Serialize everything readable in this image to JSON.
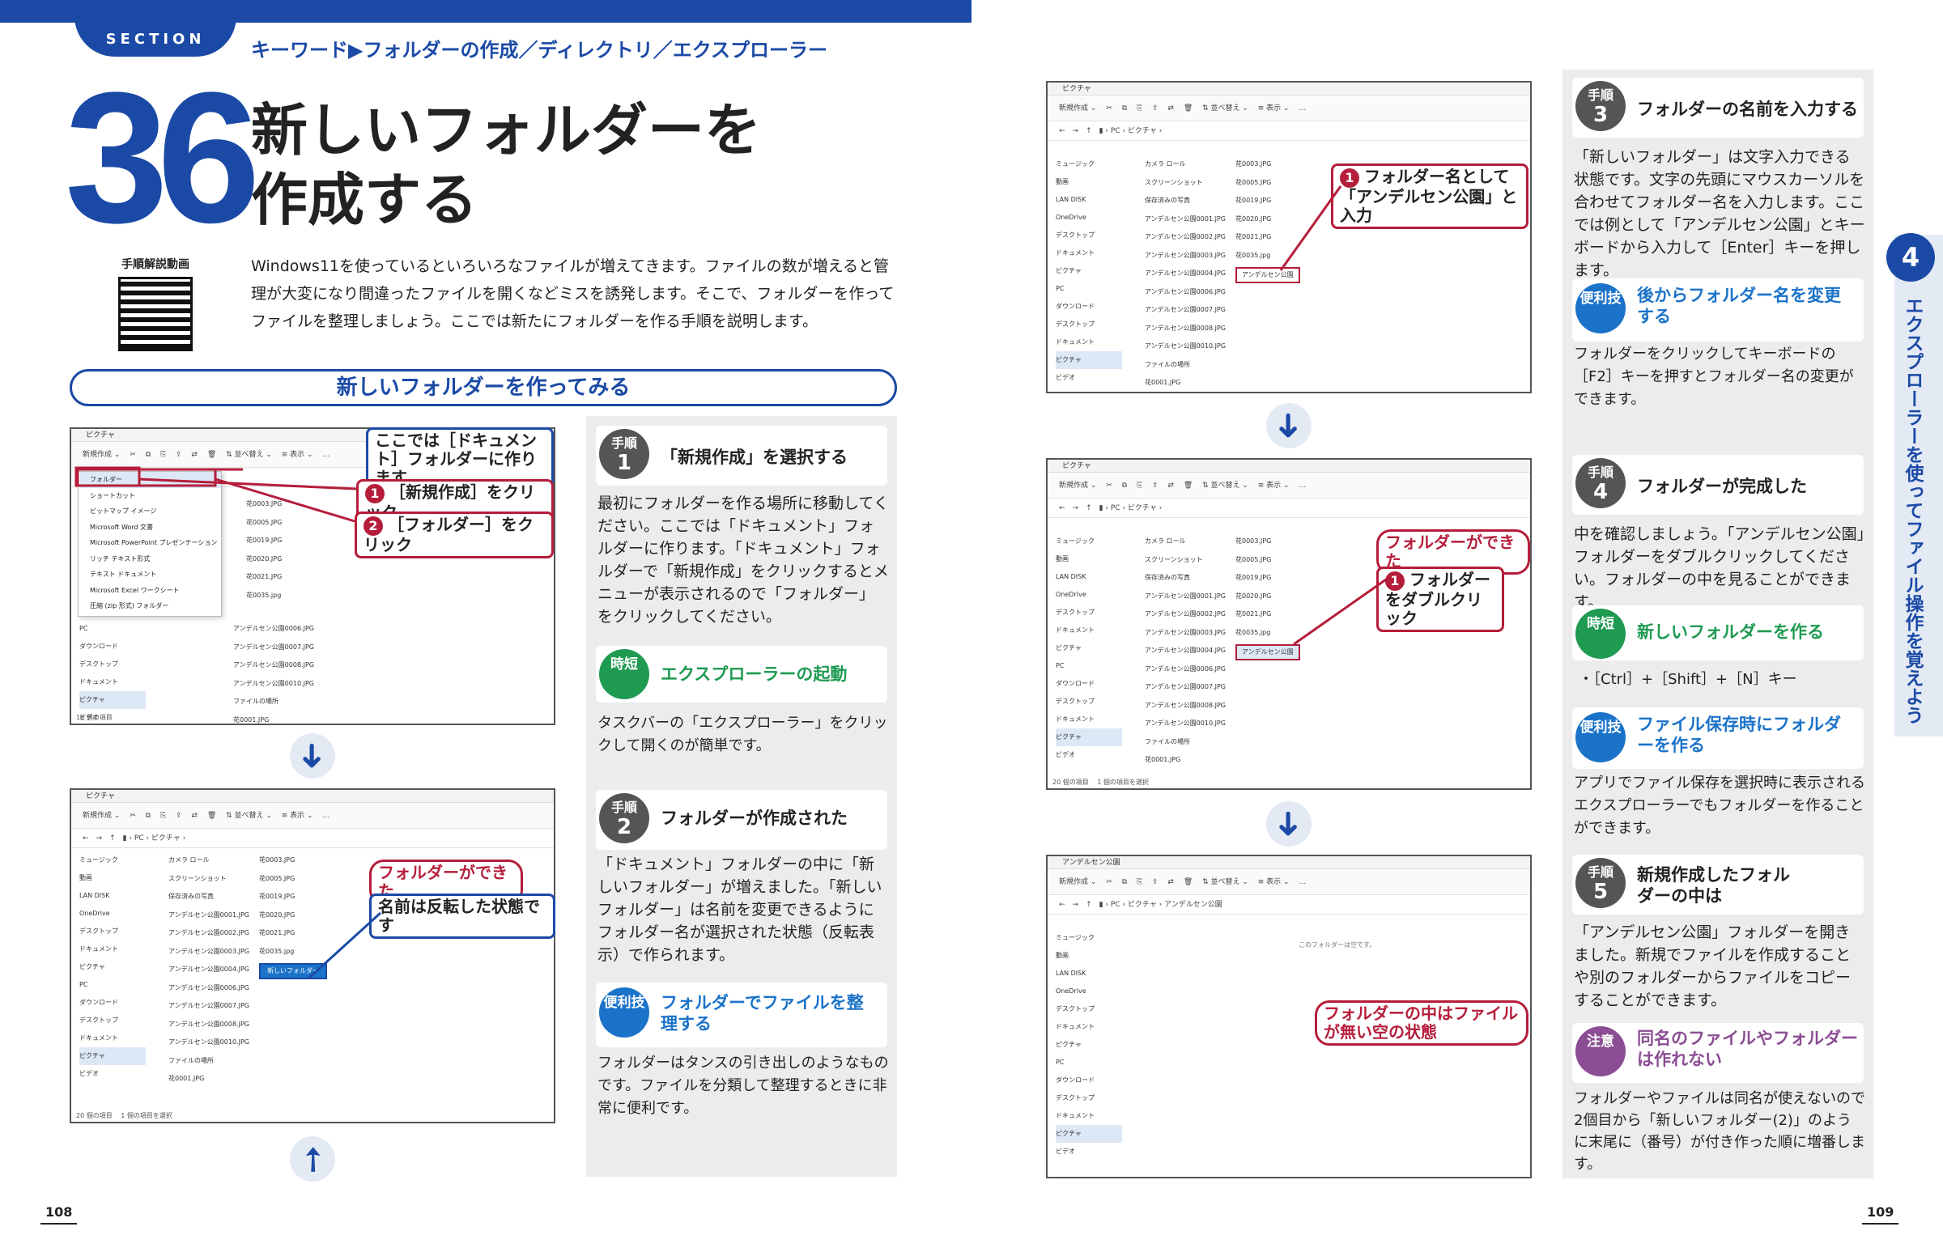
{
  "header": {
    "section_label": "SECTION",
    "keywords": "キーワード▶フォルダーの作成／ディレクトリ／エクスプローラー"
  },
  "title": {
    "number": "36",
    "line1": "新しいフォルダーを",
    "line2": "作成する"
  },
  "qr_label": "手順解説動画",
  "intro": "Windows11を使っているといろいろなファイルが増えてきます。ファイルの数が増えると管理が大変になり間違ったファイルを開くなどミスを誘発します。そこで、フォルダーを作ってファイルを整理しましょう。ここでは新たにフォルダーを作る手順を説明します。",
  "section_heading": "新しいフォルダーを作ってみる",
  "shots": {
    "window_title": "ピクチャ",
    "window_title_3": "アンデルセン公園",
    "toolbar": "新規作成 ⌄　 ✂　 ⧉　 ⎘　 ⇪　 ⇄　 🗑　 ⇅ 並べ替え ⌄　 ≡ 表示 ⌄　 …",
    "addr": "←　→　↑　▮ › PC › ピクチャ ›",
    "addr_3": "←　→　↑　▮ › PC › ピクチャ › アンデルセン公園",
    "menu": [
      "フォルダー",
      "ショートカット",
      "ビットマップ イメージ",
      "Microsoft Word 文書",
      "Microsoft PowerPoint プレゼンテーション",
      "リッチ テキスト形式",
      "テキスト ドキュメント",
      "Microsoft Excel ワークシート",
      "圧縮 (zip 形式) フォルダー"
    ],
    "nav": [
      "ミュージック",
      "動画",
      "LAN DISK",
      "OneDrive",
      "デスクトップ",
      "ドキュメント",
      "ピクチャ",
      "PC",
      "ダウンロード",
      "デスクトップ",
      "ドキュメント",
      "ピクチャ",
      "ビデオ"
    ],
    "files_col1": [
      "カメラ ロール",
      "スクリーンショット",
      "保存済みの写真",
      "アンデルセン公園0001.JPG",
      "アンデルセン公園0002.JPG",
      "アンデルセン公園0003.JPG",
      "アンデルセン公園0004.JPG",
      "アンデルセン公園0006.JPG",
      "アンデルセン公園0007.JPG",
      "アンデルセン公園0008.JPG",
      "アンデルセン公園0010.JPG",
      "ファイルの場所",
      "花0001.JPG"
    ],
    "files_col2": [
      "花0003.JPG",
      "花0005.JPG",
      "花0019.JPG",
      "花0020.JPG",
      "花0021.JPG",
      "花0035.jpg"
    ],
    "new_folder": "新しいフォルダー",
    "named_folder": "アンデルセン公園",
    "empty_msg": "このフォルダーは空です。",
    "status_1": "19 個の項目",
    "status_2": "20 個の項目　 1 個の項目を選択",
    "status_4": "20 個の項目　 1 個の項目を選択"
  },
  "callouts": {
    "c1": "ここでは［ドキュメント］フォルダーに作ります",
    "c2n": "1",
    "c2": "［新規作成］をクリック",
    "c3n": "2",
    "c3": "［フォルダー］をクリック",
    "c4": "フォルダーができた",
    "c5": "名前は反転した状態です",
    "c6n": "1",
    "c6": "フォルダー名として「アンデルセン公園」と入力",
    "c7": "フォルダーができた",
    "c8n": "1",
    "c8": "フォルダーをダブルクリック",
    "c9": "フォルダーの中はファイルが無い空の状態"
  },
  "arrows": {
    "down": "➜",
    "diag": "➚"
  },
  "steps": [
    {
      "label": "手順",
      "num": "1",
      "title": "「新規作成」を選択する",
      "body": "最初にフォルダーを作る場所に移動してください。ここでは「ドキュメント」フォルダーに作ります。「ドキュメント」フォルダーで「新規作成」をクリックするとメニューが表示されるので「フォルダー」をクリックしてください。"
    },
    {
      "label": "手順",
      "num": "2",
      "title": "フォルダーが作成された",
      "body": "「ドキュメント」フォルダーの中に「新しいフォルダー」が増えました。「新しいフォルダー」は名前を変更できるようにフォルダー名が選択された状態（反転表示）で作られます。"
    },
    {
      "label": "手順",
      "num": "3",
      "title": "フォルダーの名前を入力する",
      "body": "「新しいフォルダー」は文字入力できる状態です。文字の先頭にマウスカーソルを合わせてフォルダー名を入力します。ここでは例として「アンデルセン公園」とキーボードから入力して［Enter］キーを押します。"
    },
    {
      "label": "手順",
      "num": "4",
      "title": "フォルダーが完成した",
      "body": "中を確認しましょう。「アンデルセン公園」フォルダーをダブルクリックしてください。フォルダーの中を見ることができます。"
    },
    {
      "label": "手順",
      "num": "5",
      "title": "新規作成したフォルダーの中は",
      "body": "「アンデルセン公園」フォルダーを開きました。新規でファイルを作成することや別のフォルダーからファイルをコピーすることができます。"
    }
  ],
  "tips": [
    {
      "badge1": "時短",
      "title": "エクスプローラーの起動",
      "body": "タスクバーの「エクスプローラー」をクリックして開くのが簡単です。"
    },
    {
      "badge1": "便利技",
      "title": "フォルダーでファイルを整理する",
      "body": "フォルダーはタンスの引き出しのようなものです。ファイルを分類して整理するときに非常に便利です。"
    },
    {
      "badge1": "便利技",
      "title": "後からフォルダー名を変更する",
      "body": "フォルダーをクリックしてキーボードの［F2］キーを押すとフォルダー名の変更ができます。"
    },
    {
      "badge1": "時短",
      "title": "新しいフォルダーを作る",
      "body": "・［Ctrl］+［Shift］+［N］キー"
    },
    {
      "badge1": "便利技",
      "title": "ファイル保存時にフォルダーを作る",
      "body": "アプリでファイル保存を選択時に表示されるエクスプローラーでもフォルダーを作ることができます。"
    },
    {
      "badge1": "注意",
      "title": "同名のファイルやフォルダーは作れない",
      "body": "フォルダーやファイルは同名が使えないので2個目から「新しいフォルダー(2)」のように末尾に（番号）が付き作った順に増番します。"
    }
  ],
  "chapter": {
    "num": "4",
    "text": "エクスプローラーを使ってファイル操作を覚えよう"
  },
  "page_left": "108",
  "page_right": "109"
}
